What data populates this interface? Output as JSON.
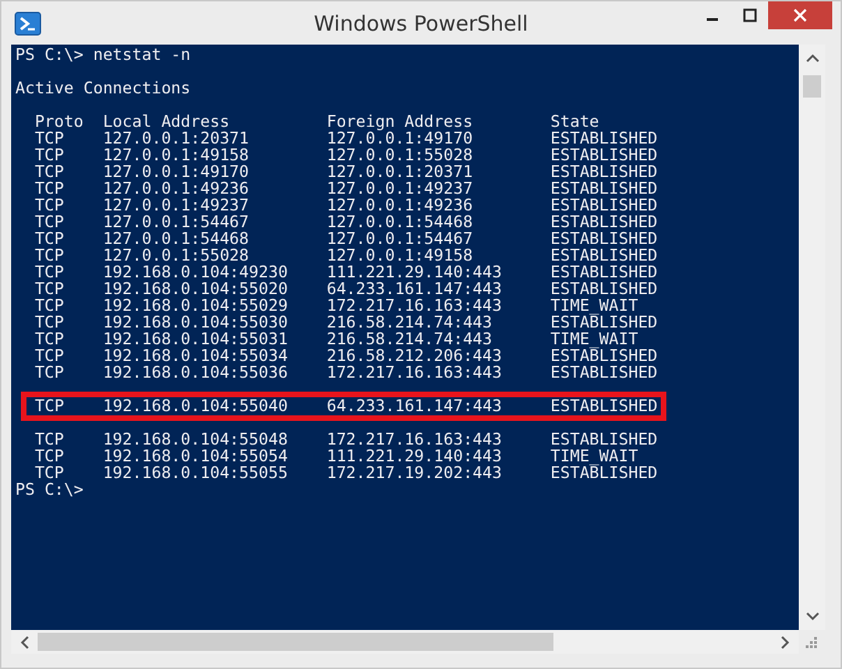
{
  "window": {
    "title": "Windows PowerShell"
  },
  "console": {
    "command_line": "PS C:\\> netstat -n",
    "heading": "Active Connections",
    "columns": [
      "Proto",
      "Local Address",
      "Foreign Address",
      "State"
    ],
    "rows": [
      {
        "proto": "TCP",
        "local": "127.0.0.1:20371",
        "foreign": "127.0.0.1:49170",
        "state": "ESTABLISHED",
        "highlighted": false
      },
      {
        "proto": "TCP",
        "local": "127.0.0.1:49158",
        "foreign": "127.0.0.1:55028",
        "state": "ESTABLISHED",
        "highlighted": false
      },
      {
        "proto": "TCP",
        "local": "127.0.0.1:49170",
        "foreign": "127.0.0.1:20371",
        "state": "ESTABLISHED",
        "highlighted": false
      },
      {
        "proto": "TCP",
        "local": "127.0.0.1:49236",
        "foreign": "127.0.0.1:49237",
        "state": "ESTABLISHED",
        "highlighted": false
      },
      {
        "proto": "TCP",
        "local": "127.0.0.1:49237",
        "foreign": "127.0.0.1:49236",
        "state": "ESTABLISHED",
        "highlighted": false
      },
      {
        "proto": "TCP",
        "local": "127.0.0.1:54467",
        "foreign": "127.0.0.1:54468",
        "state": "ESTABLISHED",
        "highlighted": false
      },
      {
        "proto": "TCP",
        "local": "127.0.0.1:54468",
        "foreign": "127.0.0.1:54467",
        "state": "ESTABLISHED",
        "highlighted": false
      },
      {
        "proto": "TCP",
        "local": "127.0.0.1:55028",
        "foreign": "127.0.0.1:49158",
        "state": "ESTABLISHED",
        "highlighted": false
      },
      {
        "proto": "TCP",
        "local": "192.168.0.104:49230",
        "foreign": "111.221.29.140:443",
        "state": "ESTABLISHED",
        "highlighted": false
      },
      {
        "proto": "TCP",
        "local": "192.168.0.104:55020",
        "foreign": "64.233.161.147:443",
        "state": "ESTABLISHED",
        "highlighted": false
      },
      {
        "proto": "TCP",
        "local": "192.168.0.104:55029",
        "foreign": "172.217.16.163:443",
        "state": "TIME_WAIT",
        "highlighted": false
      },
      {
        "proto": "TCP",
        "local": "192.168.0.104:55030",
        "foreign": "216.58.214.74:443",
        "state": "ESTABLISHED",
        "highlighted": false
      },
      {
        "proto": "TCP",
        "local": "192.168.0.104:55031",
        "foreign": "216.58.214.74:443",
        "state": "TIME_WAIT",
        "highlighted": false
      },
      {
        "proto": "TCP",
        "local": "192.168.0.104:55034",
        "foreign": "216.58.212.206:443",
        "state": "ESTABLISHED",
        "highlighted": false
      },
      {
        "proto": "TCP",
        "local": "192.168.0.104:55036",
        "foreign": "172.217.16.163:443",
        "state": "ESTABLISHED",
        "highlighted": false
      },
      {
        "proto": "TCP",
        "local": "192.168.0.104:55040",
        "foreign": "64.233.161.147:443",
        "state": "ESTABLISHED",
        "highlighted": true
      },
      {
        "proto": "TCP",
        "local": "192.168.0.104:55048",
        "foreign": "172.217.16.163:443",
        "state": "ESTABLISHED",
        "highlighted": false
      },
      {
        "proto": "TCP",
        "local": "192.168.0.104:55054",
        "foreign": "111.221.29.140:443",
        "state": "TIME_WAIT",
        "highlighted": false
      },
      {
        "proto": "TCP",
        "local": "192.168.0.104:55055",
        "foreign": "172.217.19.202:443",
        "state": "ESTABLISHED",
        "highlighted": false
      }
    ],
    "final_prompt": "PS C:\\>"
  }
}
